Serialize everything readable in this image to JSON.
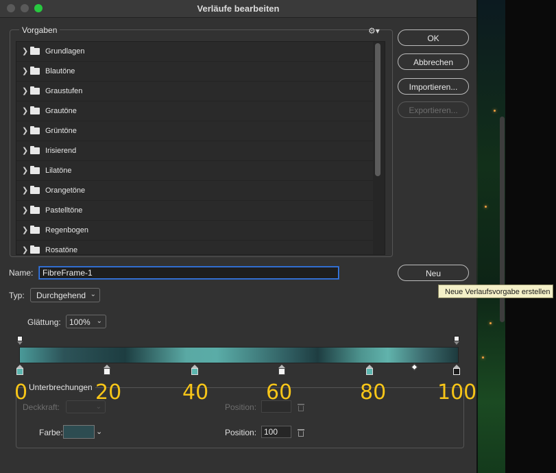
{
  "window": {
    "title": "Verläufe bearbeiten"
  },
  "presets": {
    "group_label": "Vorgaben",
    "items": [
      "Grundlagen",
      "Blautöne",
      "Graustufen",
      "Grautöne",
      "Grüntöne",
      "Irisierend",
      "Lilatöne",
      "Orangetöne",
      "Pastelltöne",
      "Regenbogen",
      "Rosatöne"
    ]
  },
  "buttons": {
    "ok": "OK",
    "cancel": "Abbrechen",
    "import": "Importieren...",
    "export": "Exportieren...",
    "new": "Neu"
  },
  "tooltip": "Neue Verlaufsvorgabe erstellen",
  "name": {
    "label": "Name:",
    "value": "FibreFrame-1"
  },
  "type": {
    "label": "Typ:",
    "value": "Durchgehend"
  },
  "smoothness": {
    "label": "Glättung:",
    "value": "100%"
  },
  "gradient": {
    "colors": [
      "#4a9a99",
      "#2d5358",
      "#1d3d41",
      "#5aa9a4",
      "#2e5a5e",
      "#1e3d41",
      "#61b3ac",
      "#1d3a3d"
    ],
    "stop_positions": [
      0,
      20,
      40,
      60,
      80,
      100
    ]
  },
  "overlay_labels": [
    "0",
    "20",
    "40",
    "60",
    "80",
    "100"
  ],
  "stops_section": {
    "label": "Unterbrechungen",
    "opacity_label": "Deckkraft:",
    "opacity_position_label": "Position:",
    "color_label": "Farbe:",
    "color_swatch": "#2d4c51",
    "color_position_label": "Position:",
    "color_position_value": "100"
  }
}
